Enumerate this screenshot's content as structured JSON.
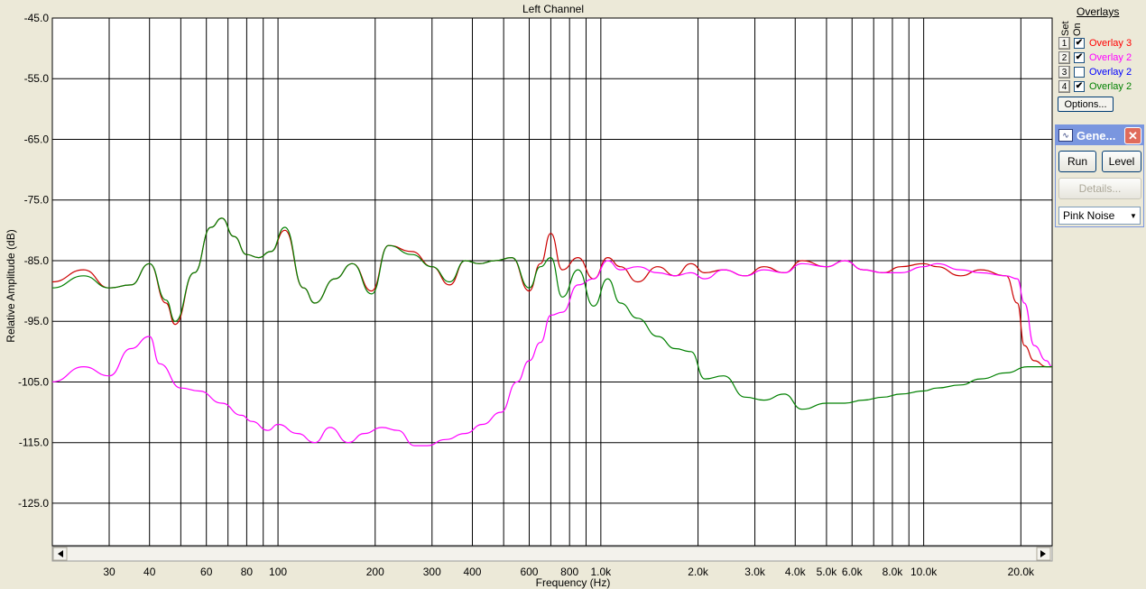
{
  "plot": {
    "title": "Left Channel",
    "ylabel": "Relative Amplitude (dB)",
    "xlabel": "Frequency (Hz)"
  },
  "overlays": {
    "title": "Overlays",
    "col_set": "Set",
    "col_on": "On",
    "rows": [
      {
        "num": "1",
        "checked": true,
        "label": "Overlay 3",
        "color": "#ff0000"
      },
      {
        "num": "2",
        "checked": true,
        "label": "Overlay 2",
        "color": "#ff00ff"
      },
      {
        "num": "3",
        "checked": false,
        "label": "Overlay 2",
        "color": "#0000ff"
      },
      {
        "num": "4",
        "checked": true,
        "label": "Overlay 2",
        "color": "#008000"
      }
    ],
    "options_label": "Options..."
  },
  "generator": {
    "title": "Gene...",
    "icon": "waveform-icon",
    "run_label": "Run",
    "level_label": "Level",
    "details_label": "Details...",
    "selected": "Pink Noise"
  },
  "chart_data": {
    "type": "line",
    "title": "Left Channel",
    "xlabel": "Frequency (Hz)",
    "ylabel": "Relative Amplitude (dB)",
    "xscale": "log",
    "xlim": [
      20,
      25000
    ],
    "ylim": [
      -132,
      -45
    ],
    "grid": true,
    "yticks": [
      -45.0,
      -55.0,
      -65.0,
      -75.0,
      -85.0,
      -95.0,
      -105.0,
      -115.0,
      -125.0
    ],
    "ytick_labels": [
      "-45.0",
      "-55.0",
      "-65.0",
      "-75.0",
      "-85.0",
      "-95.0",
      "-105.0",
      "-115.0",
      "-125.0"
    ],
    "xticks": [
      30,
      40,
      60,
      80,
      100,
      200,
      300,
      400,
      600,
      800,
      1000,
      2000,
      3000,
      4000,
      5000,
      6000,
      8000,
      10000,
      20000
    ],
    "xtick_labels": [
      "30",
      "40",
      "60",
      "80",
      "100",
      "200",
      "300",
      "400",
      "600",
      "800",
      "1.0k",
      "2.0k",
      "3.0k",
      "4.0k",
      "5.0k",
      "6.0k",
      "8.0k",
      "10.0k",
      "20.0k"
    ],
    "major_gridlines_x": [
      30,
      40,
      50,
      60,
      70,
      80,
      90,
      100,
      200,
      300,
      400,
      500,
      600,
      700,
      800,
      900,
      1000,
      2000,
      3000,
      4000,
      5000,
      6000,
      7000,
      8000,
      9000,
      10000,
      20000
    ],
    "series": [
      {
        "color": "#cc0000",
        "x": [
          20,
          25,
          30,
          35,
          40,
          45,
          48,
          55,
          62,
          67,
          73,
          80,
          87,
          95,
          105,
          120,
          130,
          150,
          170,
          195,
          220,
          260,
          300,
          340,
          380,
          420,
          470,
          530,
          600,
          650,
          700,
          760,
          850,
          950,
          1050,
          1150,
          1300,
          1500,
          1700,
          1900,
          2100,
          2400,
          2800,
          3200,
          3700,
          4200,
          5000,
          5700,
          6500,
          7500,
          8500,
          10000,
          11000,
          13000,
          15000,
          18000,
          19500,
          20500,
          22000,
          24000,
          25000
        ],
        "y": [
          -88.5,
          -86.5,
          -89.5,
          -89,
          -85.5,
          -92,
          -95.5,
          -87,
          -79.5,
          -78,
          -81,
          -84,
          -84.5,
          -83.5,
          -80,
          -89.5,
          -92,
          -88,
          -85.5,
          -90,
          -82.5,
          -83.5,
          -86,
          -89,
          -85,
          -85.5,
          -85,
          -84.5,
          -90,
          -85.5,
          -80.5,
          -86.5,
          -84.5,
          -88,
          -84.5,
          -86,
          -88.5,
          -86,
          -87.5,
          -85.5,
          -87,
          -86.5,
          -87.5,
          -86,
          -87,
          -85,
          -86,
          -85,
          -86.5,
          -87,
          -86,
          -85.5,
          -86,
          -87.5,
          -86.5,
          -87.5,
          -92,
          -99,
          -101.5,
          -102.5,
          -102.5
        ]
      },
      {
        "color": "#ff00ff",
        "x": [
          20,
          25,
          30,
          35,
          40,
          43,
          50,
          57,
          67,
          77,
          83,
          93,
          100,
          115,
          130,
          145,
          165,
          185,
          210,
          235,
          265,
          290,
          330,
          380,
          430,
          490,
          550,
          600,
          650,
          700,
          760,
          850,
          950,
          1050,
          1150,
          1300,
          1500,
          1700,
          1900,
          2100,
          2400,
          2800,
          3200,
          3700,
          4200,
          5000,
          5700,
          6500,
          7500,
          8500,
          10000,
          11000,
          13000,
          15000,
          18000,
          19500,
          20500,
          22000,
          24000,
          25000
        ],
        "y": [
          -105,
          -102.5,
          -104,
          -99.5,
          -97.5,
          -102,
          -106,
          -106.5,
          -108.5,
          -110.5,
          -111.5,
          -113,
          -112,
          -113.5,
          -115,
          -112.5,
          -115,
          -113.5,
          -112.5,
          -113,
          -115.5,
          -115.5,
          -114.5,
          -113.5,
          -112,
          -110,
          -105,
          -101.5,
          -98.5,
          -94,
          -93.5,
          -89,
          -88,
          -85,
          -86.5,
          -86,
          -87,
          -87.5,
          -87,
          -88,
          -86.5,
          -87.5,
          -86.5,
          -87,
          -85.5,
          -86,
          -85,
          -86.5,
          -87,
          -87,
          -86,
          -85.5,
          -86.5,
          -87,
          -87.5,
          -88,
          -92,
          -99,
          -101.5,
          -102.5
        ]
      },
      {
        "color": "#008000",
        "x": [
          20,
          25,
          30,
          35,
          40,
          45,
          48,
          55,
          62,
          67,
          73,
          80,
          87,
          95,
          105,
          120,
          130,
          150,
          170,
          195,
          220,
          260,
          300,
          340,
          380,
          420,
          470,
          530,
          600,
          650,
          700,
          760,
          850,
          950,
          1050,
          1150,
          1300,
          1500,
          1700,
          1900,
          2100,
          2400,
          2800,
          3200,
          3700,
          4200,
          5000,
          5700,
          6500,
          7500,
          8500,
          10000,
          11000,
          13000,
          15000,
          18000,
          21000,
          24000,
          25000
        ],
        "y": [
          -89.5,
          -87.5,
          -89.5,
          -89,
          -85.5,
          -91.5,
          -95,
          -87,
          -79.5,
          -78,
          -81,
          -84,
          -84.5,
          -83.5,
          -79.5,
          -89.5,
          -92,
          -88,
          -85.5,
          -90.5,
          -82.5,
          -84,
          -86,
          -88.5,
          -85,
          -85.5,
          -85,
          -84.5,
          -89.5,
          -86,
          -84.5,
          -91,
          -86.5,
          -92.5,
          -88,
          -92,
          -94.5,
          -97.5,
          -99.5,
          -100,
          -104.5,
          -104,
          -107.5,
          -108,
          -107,
          -109.5,
          -108.5,
          -108.5,
          -108,
          -107.5,
          -107,
          -106.5,
          -106,
          -105.5,
          -104.5,
          -103.5,
          -102.5,
          -102.5,
          -102.5
        ]
      }
    ]
  }
}
